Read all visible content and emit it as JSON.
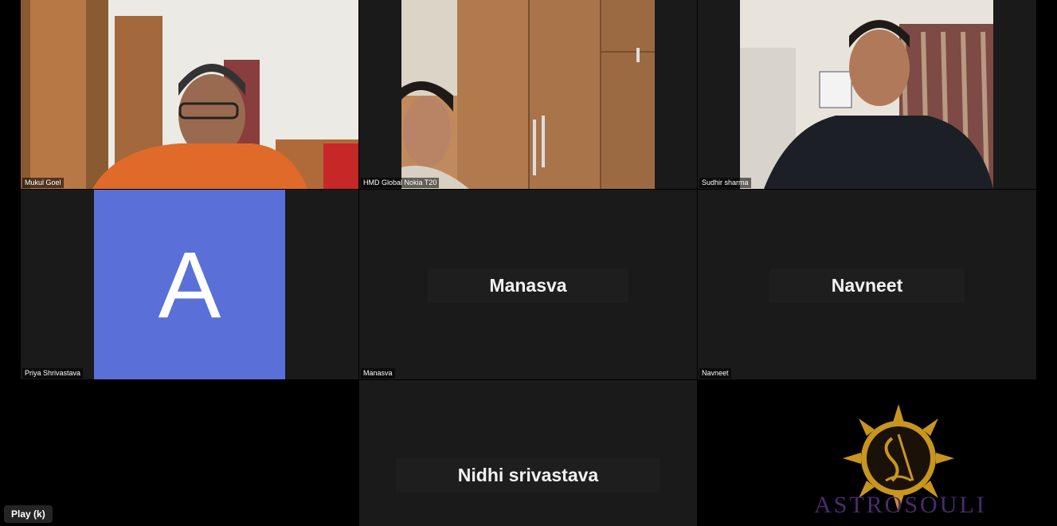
{
  "participants": {
    "mukul": {
      "name": "Mukul Goel"
    },
    "hmd": {
      "name": "HMD Global Nokia T20"
    },
    "sudhir": {
      "name": "Sudhir sharma"
    },
    "priya": {
      "name": "Priya Shrivastava",
      "avatar_letter": "A",
      "avatar_color": "#5b6fd8"
    },
    "manasva": {
      "name": "Manasva",
      "display": "Manasva"
    },
    "navneet": {
      "name": "Navneet",
      "display": "Navneet"
    },
    "nidhi": {
      "display": "Nidhi srivastava"
    },
    "astrosoul": {
      "logo_text": "ASTROSOULI"
    }
  },
  "player": {
    "play_label": "Play (k)"
  },
  "colors": {
    "tile_bg": "#1a1a1a",
    "logo_gold": "#c8961e",
    "logo_purple": "#4a2a6e"
  }
}
